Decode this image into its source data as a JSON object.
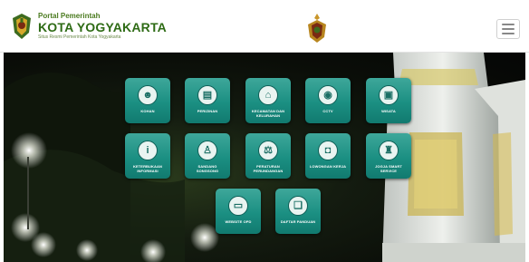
{
  "header": {
    "brand_small": "Portal Pemerintah",
    "brand_main": "KOTA YOGYAKARTA",
    "brand_sub": "Situs Resmi Pemerintah Kota Yogyakarta"
  },
  "colors": {
    "brand_green": "#2e6b15",
    "tile_teal": "#1b8f82",
    "header_bg": "#ffffff"
  },
  "tiles": [
    {
      "label": "KOHAN",
      "icon": "people-icon"
    },
    {
      "label": "PERIZINAN",
      "icon": "document-icon"
    },
    {
      "label": "KECAMATAN DAN KELURAHAN",
      "icon": "building-icon"
    },
    {
      "label": "CCTV",
      "icon": "camera-icon"
    },
    {
      "label": "WISATA",
      "icon": "map-icon"
    },
    {
      "label": "KETERBUKAAN INFORMASI",
      "icon": "info-icon"
    },
    {
      "label": "SANDANG SONGSONG",
      "icon": "person-icon"
    },
    {
      "label": "PERATURAN PERUNDANGAN",
      "icon": "scale-icon"
    },
    {
      "label": "LOWONGAN KERJA",
      "icon": "briefcase-icon"
    },
    {
      "label": "JOGJA SMART SERVICE",
      "icon": "crest-icon"
    },
    {
      "label": "WEBSITE OPD",
      "icon": "window-icon"
    },
    {
      "label": "DAFTAR PANDUAN",
      "icon": "book-icon"
    }
  ]
}
